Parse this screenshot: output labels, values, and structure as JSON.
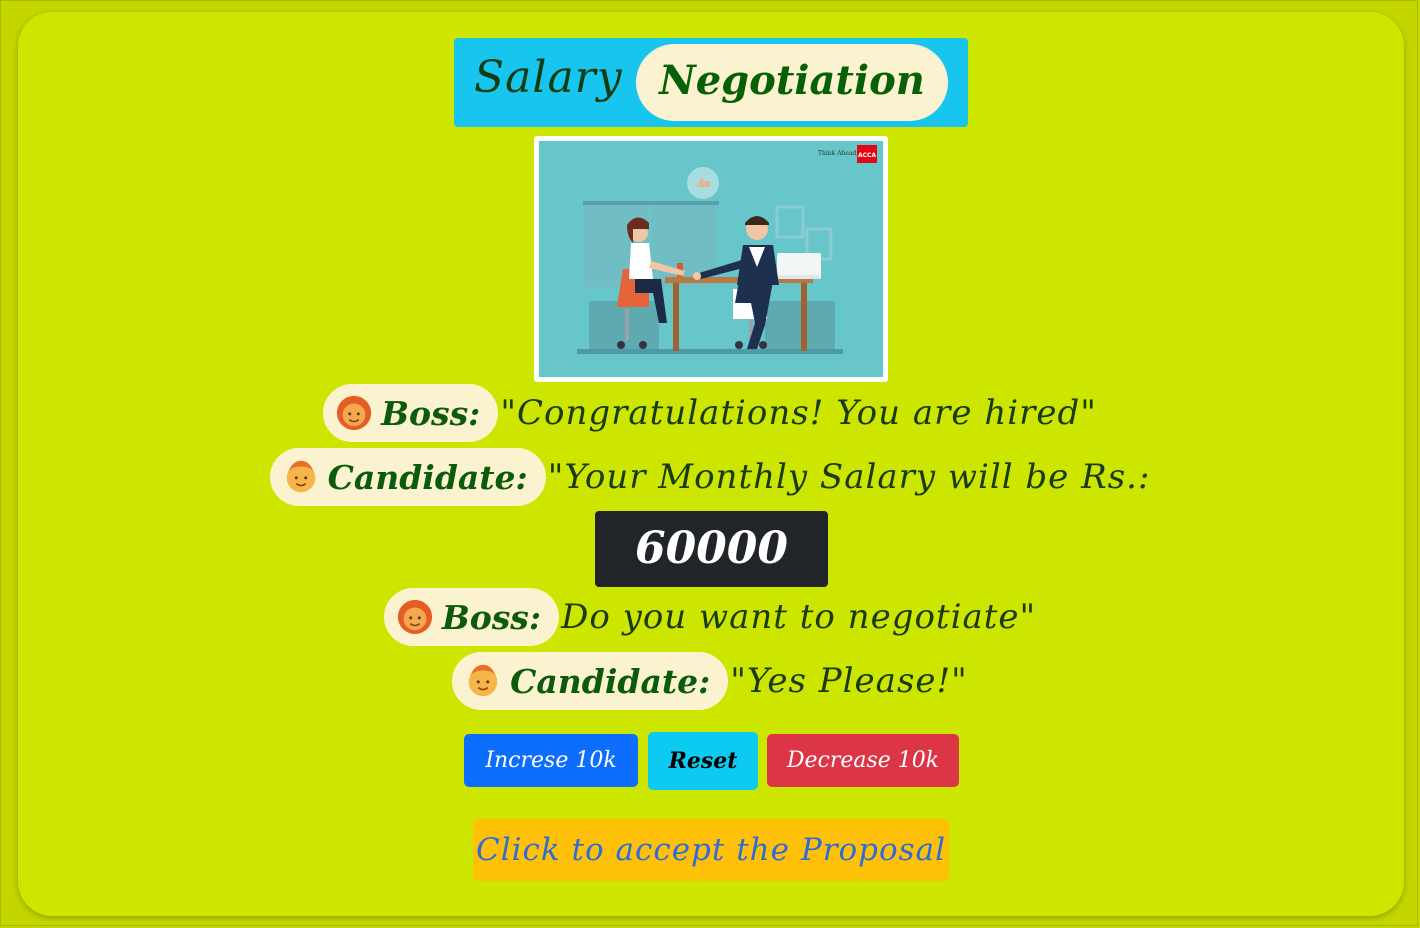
{
  "title": {
    "plain": "Salary",
    "emphasis": "Negotiation"
  },
  "illustration": {
    "description_icon": "office-handshake-illustration",
    "brand_tagline": "Think Ahead",
    "brand_logo": "ACCA"
  },
  "dialogue": [
    {
      "speaker": "Boss:",
      "icon": "woman-face-icon",
      "text": "\"Congratulations! You are hired\""
    },
    {
      "speaker": "Candidate:",
      "icon": "man-face-icon",
      "text": "\"Your Monthly Salary will be Rs.:"
    },
    {
      "speaker": "Boss:",
      "icon": "woman-face-icon",
      "text": "Do you want to negotiate\""
    },
    {
      "speaker": "Candidate:",
      "icon": "man-face-icon",
      "text": "\"Yes Please!\""
    }
  ],
  "salary": {
    "value": "60000"
  },
  "buttons": {
    "increase": "Increse 10k",
    "reset": "Reset",
    "decrease": "Decrease 10k",
    "accept": "Click to accept the Proposal"
  },
  "colors": {
    "page_bg": "#c4d600",
    "card_bg": "#cce600",
    "title_bg": "#17c5ee",
    "pill_bg": "#fbf3cf",
    "speaker_text": "#0c5a0c",
    "salary_bg": "#212529",
    "increase_btn": "#0d6efd",
    "reset_btn": "#0dcaf0",
    "decrease_btn": "#dc3545",
    "accept_btn": "#ffc107",
    "accept_text": "#2f6cd8"
  }
}
